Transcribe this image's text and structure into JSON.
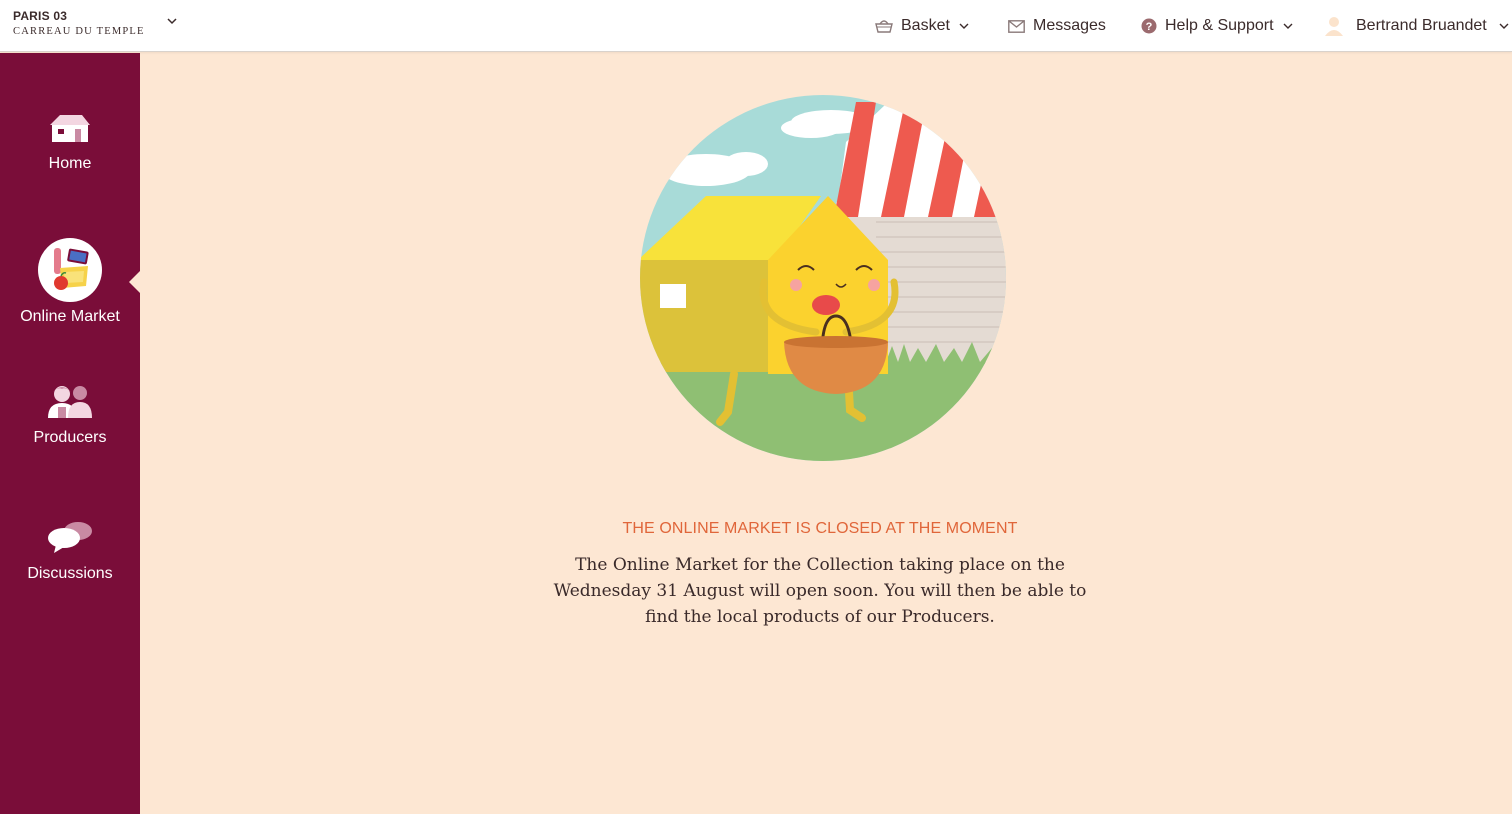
{
  "brand": {
    "city": "PARIS 03",
    "location": "CARREAU DU TEMPLE"
  },
  "topnav": {
    "basket_label": "Basket",
    "messages_label": "Messages",
    "help_label": "Help & Support",
    "user_name": "Bertrand Bruandet"
  },
  "sidebar": {
    "items": [
      {
        "label": "Home",
        "icon": "house-icon"
      },
      {
        "label": "Online Market",
        "icon": "market-basket-icon",
        "active": true
      },
      {
        "label": "Producers",
        "icon": "producers-icon"
      },
      {
        "label": "Discussions",
        "icon": "speech-bubbles-icon"
      }
    ]
  },
  "main": {
    "status_title": "THE ONLINE MARKET IS CLOSED AT THE MOMENT",
    "status_message": "The Online Market for the Collection taking place on the Wednesday 31 August will open soon. You will then be able to find the local products of our Producers."
  },
  "colors": {
    "sidebar_bg": "#7a0d39",
    "page_bg": "#fde7d3",
    "accent_orange": "#e0663a",
    "text_dark": "#3a2a2a"
  }
}
